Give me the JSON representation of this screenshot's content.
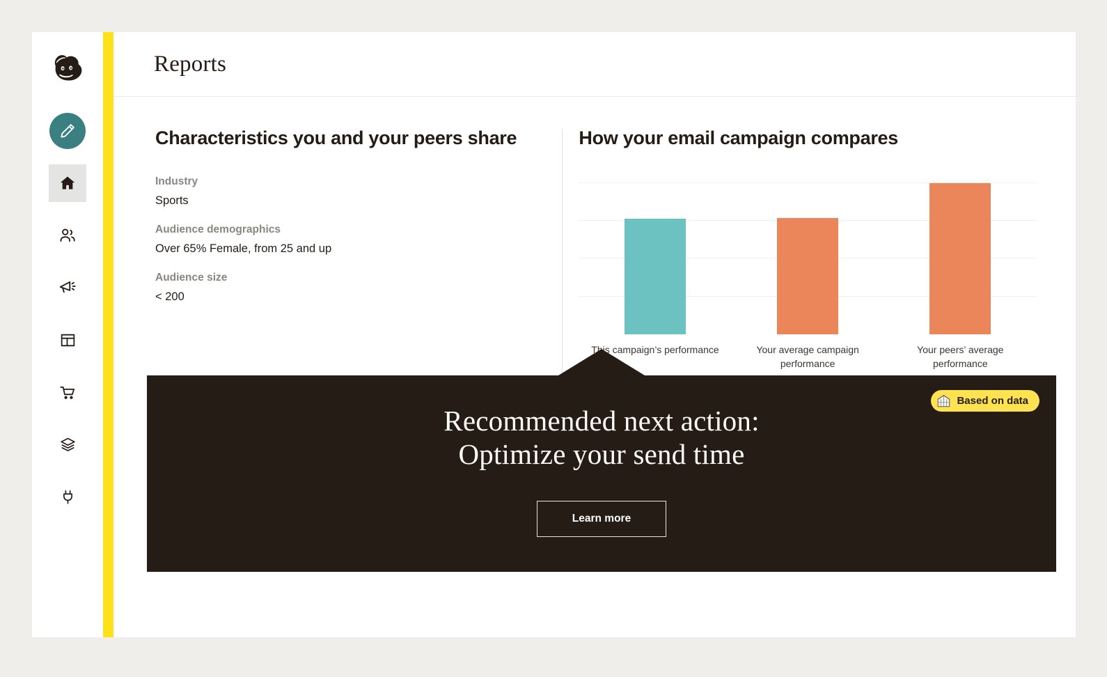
{
  "window": {
    "brand_logo": "mailchimp-freddie-logo",
    "accent_yellow": "#ffe01b",
    "dark": "#241c15"
  },
  "sidebar": {
    "compose": {
      "label": "Create",
      "icon": "pencil-icon",
      "color": "#3a7f82"
    },
    "items": [
      {
        "name": "home",
        "icon": "home-icon",
        "label": "Home",
        "active": true
      },
      {
        "name": "audience",
        "icon": "people-icon",
        "label": "Audience",
        "active": false
      },
      {
        "name": "campaigns",
        "icon": "megaphone-icon",
        "label": "Campaigns",
        "active": false
      },
      {
        "name": "content",
        "icon": "layout-icon",
        "label": "Content",
        "active": false
      },
      {
        "name": "commerce",
        "icon": "cart-icon",
        "label": "Commerce",
        "active": false
      },
      {
        "name": "automations",
        "icon": "layers-icon",
        "label": "Automations",
        "active": false
      },
      {
        "name": "integrations",
        "icon": "plug-icon",
        "label": "Integrations",
        "active": false
      }
    ]
  },
  "header": {
    "title": "Reports"
  },
  "characteristics": {
    "heading": "Characteristics you and your peers share",
    "fields": [
      {
        "label": "Industry",
        "value": "Sports"
      },
      {
        "label": "Audience demographics",
        "value": "Over 65% Female, from 25 and up"
      },
      {
        "label": "Audience size",
        "value": "< 200"
      }
    ]
  },
  "comparison": {
    "heading": "How your email campaign compares"
  },
  "chart_data": {
    "type": "bar",
    "title": "How your email campaign compares",
    "categories": [
      "This campaign’s performance",
      "Your average campaign performance",
      "Your peers’ average performance"
    ],
    "values": [
      3.05,
      3.07,
      4.0
    ],
    "colors": [
      "#6bc2c1",
      "#ea8659",
      "#ea8659"
    ],
    "xlabel": "",
    "ylabel": "",
    "ylim": [
      0,
      4.2
    ],
    "gridlines": [
      1,
      2,
      3,
      4
    ],
    "grid": true,
    "legend": "none",
    "axis_tick_labels": []
  },
  "banner": {
    "badge": {
      "icon": "greenhouse-icon",
      "text": "Based on data",
      "background": "#ffe24f"
    },
    "headline_line1": "Recommended next action:",
    "headline_line2": "Optimize your send time",
    "cta_label": "Learn more"
  }
}
